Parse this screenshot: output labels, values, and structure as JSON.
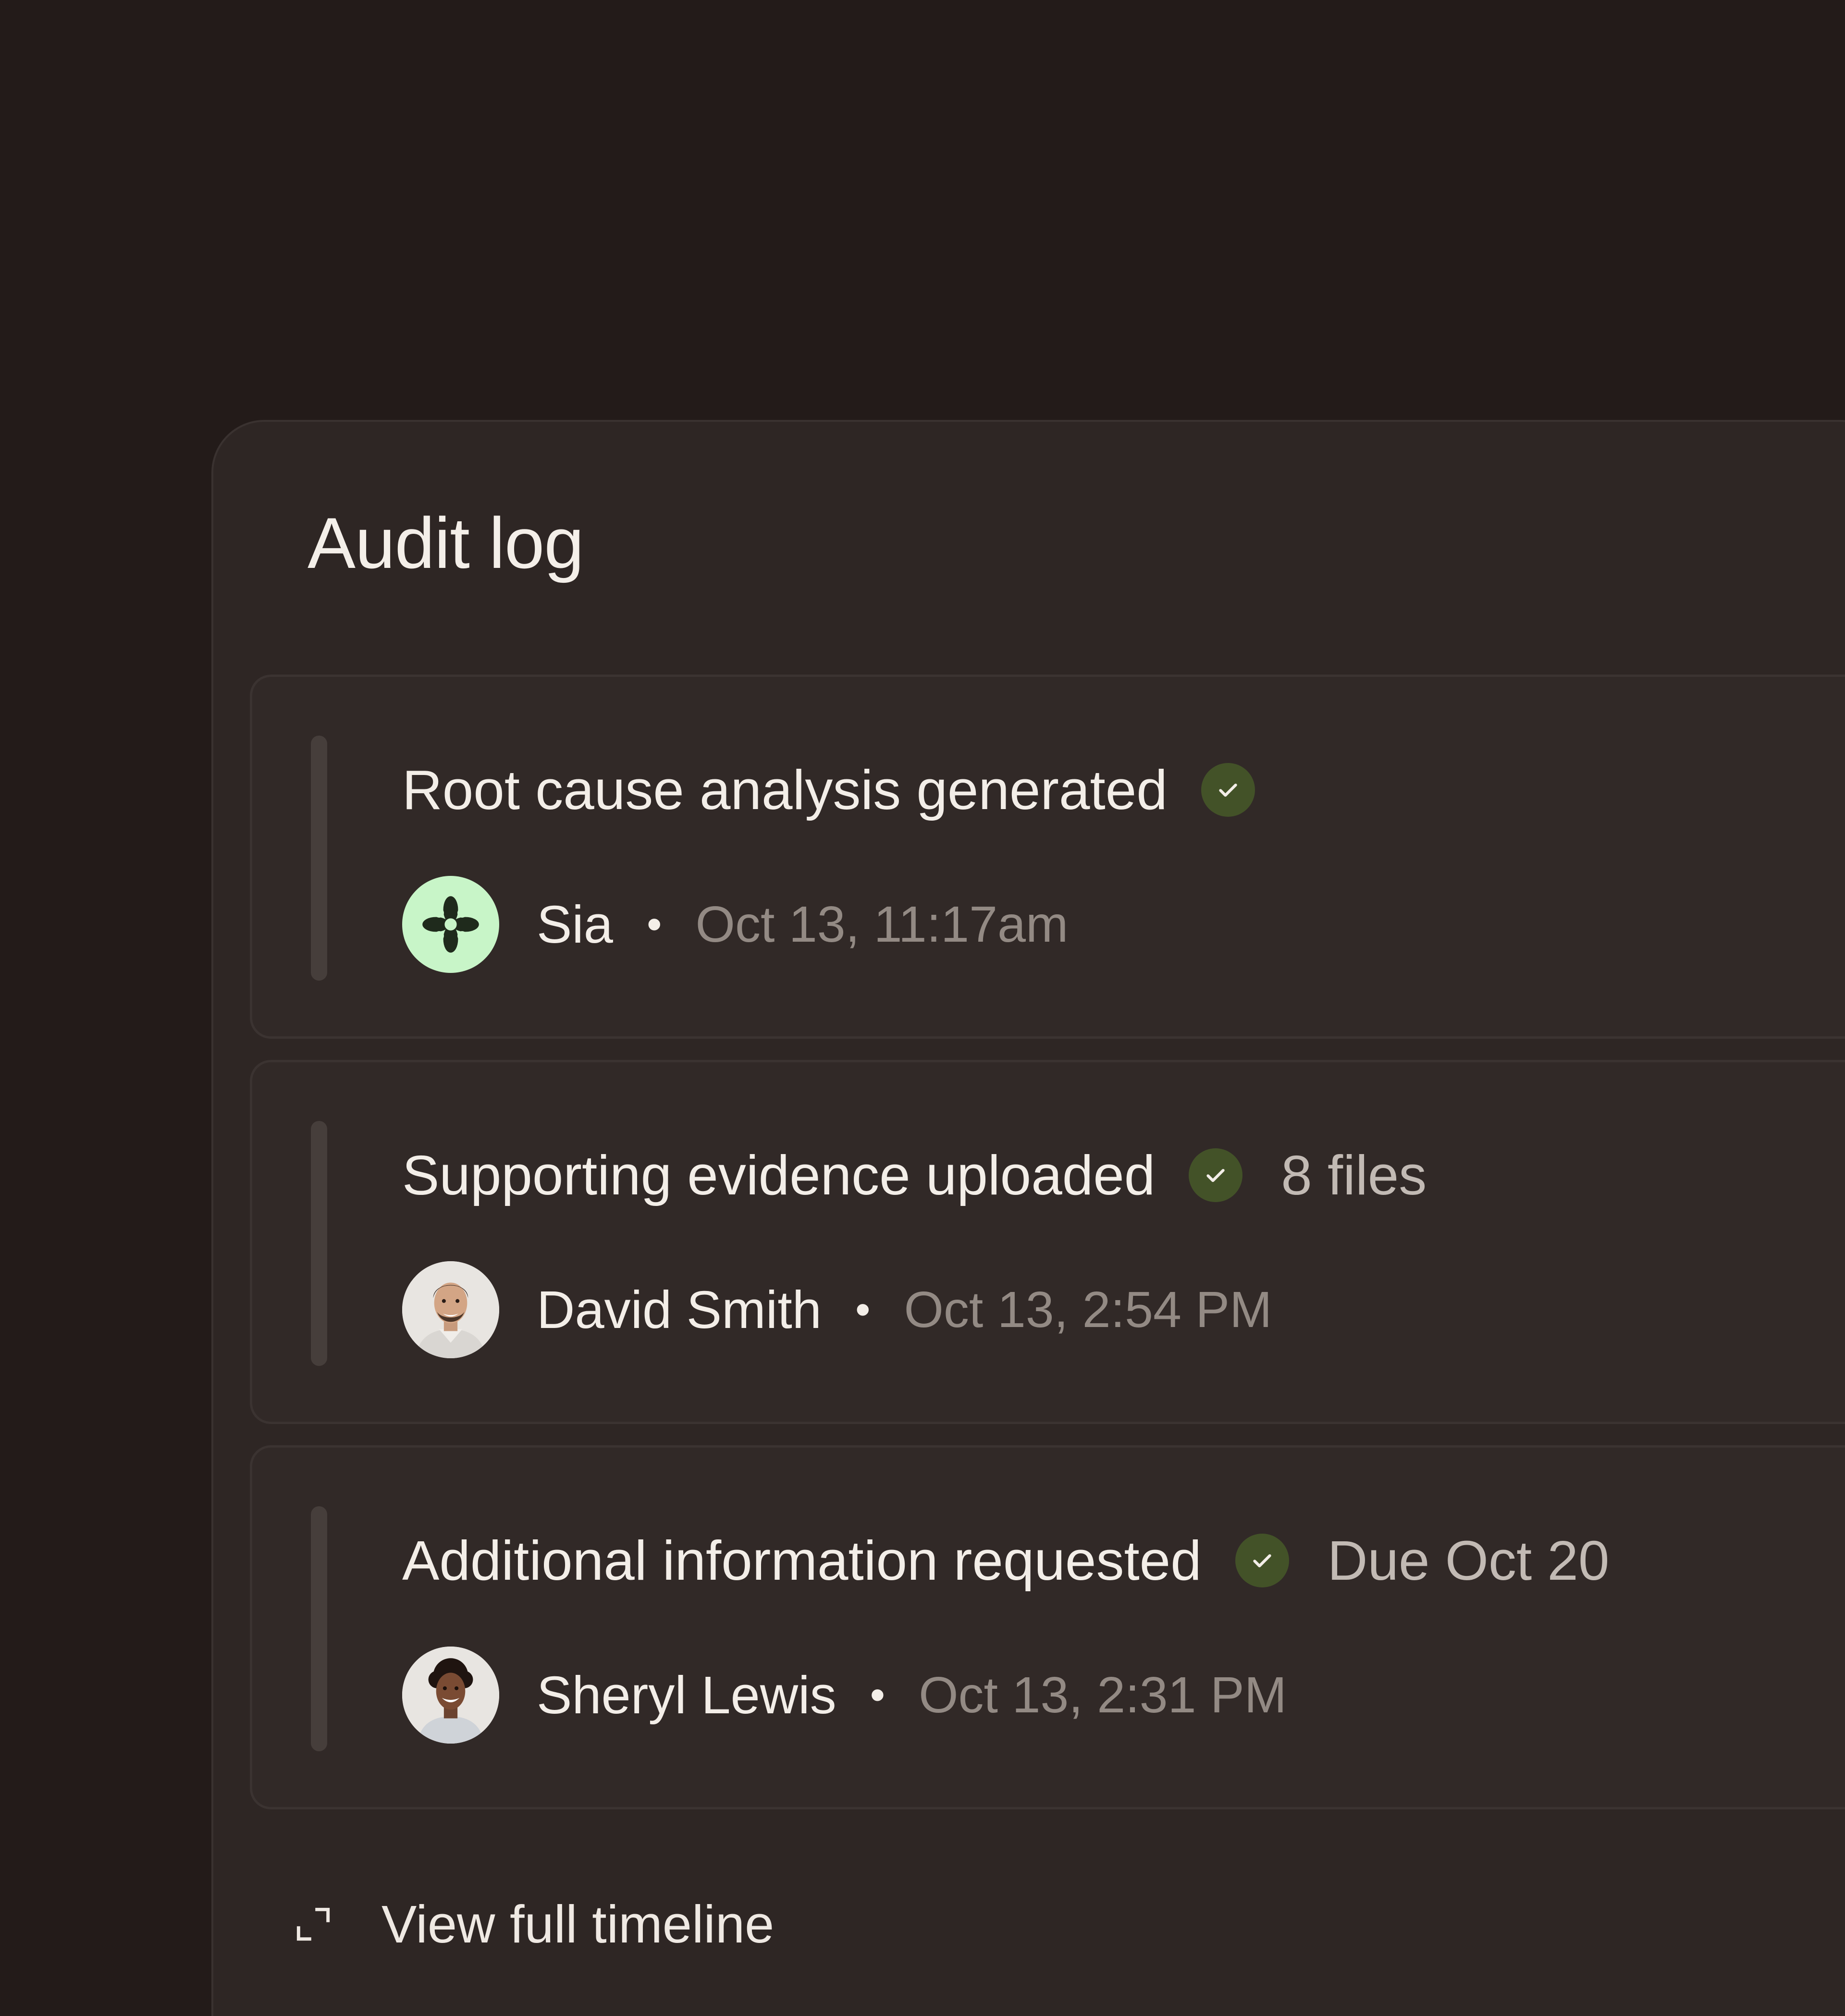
{
  "panel": {
    "title": "Audit log"
  },
  "entries": [
    {
      "title": "Root cause analysis generated",
      "status_icon": "check-circle-icon",
      "extra": "",
      "actor": "Sia",
      "avatar": "sia-logo-avatar",
      "separator": "•",
      "timestamp": "Oct 13, 11:17am"
    },
    {
      "title": "Supporting evidence uploaded",
      "status_icon": "check-circle-icon",
      "extra": "8 files",
      "actor": "David Smith",
      "avatar": "user-photo-avatar",
      "separator": "•",
      "timestamp": "Oct 13, 2:54 PM"
    },
    {
      "title": "Additional information requested",
      "status_icon": "check-circle-icon",
      "extra": "Due Oct 20",
      "actor": "Sheryl Lewis",
      "avatar": "user-photo-avatar",
      "separator": "•",
      "timestamp": "Oct 13, 2:31 PM"
    }
  ],
  "footer": {
    "link_label": "View full timeline",
    "link_icon": "expand-icon"
  },
  "colors": {
    "background": "#231b19",
    "panel": "#2e2624",
    "card": "#312927",
    "check_badge": "#435228",
    "sia_avatar": "#c8f5c8"
  }
}
